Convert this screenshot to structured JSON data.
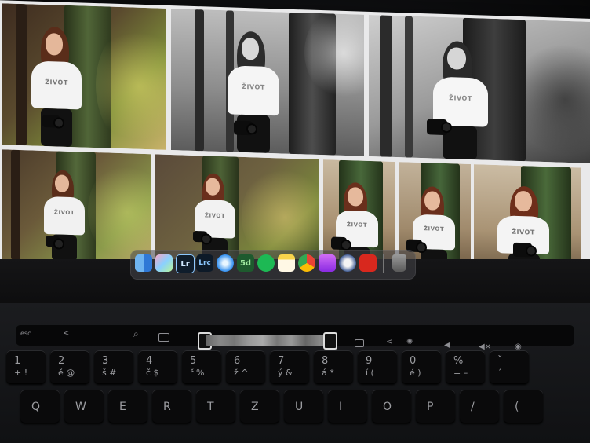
{
  "shirt_text": "ŽIVOT",
  "dock": {
    "apps": [
      {
        "name": "finder",
        "label": ""
      },
      {
        "name": "launchpad",
        "label": ""
      },
      {
        "name": "lightroom",
        "label": "Lr"
      },
      {
        "name": "lightroom-classic",
        "label": "Lrc"
      },
      {
        "name": "safari",
        "label": ""
      },
      {
        "name": "app-5d",
        "label": "5d"
      },
      {
        "name": "spotify",
        "label": ""
      },
      {
        "name": "notes",
        "label": ""
      },
      {
        "name": "chrome",
        "label": ""
      },
      {
        "name": "podcasts",
        "label": ""
      },
      {
        "name": "app-swirl",
        "label": ""
      },
      {
        "name": "acrobat",
        "label": ""
      },
      {
        "name": "trash",
        "label": ""
      }
    ]
  },
  "touchbar": {
    "esc": "esc",
    "back": "<",
    "search": "⌕"
  },
  "keys": {
    "row1": [
      {
        "a": "1",
        "b": "+ !"
      },
      {
        "a": "2",
        "b": "ě @"
      },
      {
        "a": "3",
        "b": "š #"
      },
      {
        "a": "4",
        "b": "č $"
      },
      {
        "a": "5",
        "b": "ř %"
      },
      {
        "a": "6",
        "b": "ž ^"
      },
      {
        "a": "7",
        "b": "ý &"
      },
      {
        "a": "8",
        "b": "á *"
      },
      {
        "a": "9",
        "b": "í ("
      },
      {
        "a": "0",
        "b": "é )"
      },
      {
        "a": "%",
        "b": "= –"
      },
      {
        "a": "ˇ",
        "b": "´"
      }
    ],
    "row2": [
      "Q",
      "W",
      "E",
      "R",
      "T",
      "Z",
      "U",
      "I",
      "O",
      "P",
      "/",
      "("
    ]
  },
  "colors": {
    "screen_bg": "#e9e9ea",
    "dock_bg": "#46464a",
    "key": "#0a0a0b"
  }
}
